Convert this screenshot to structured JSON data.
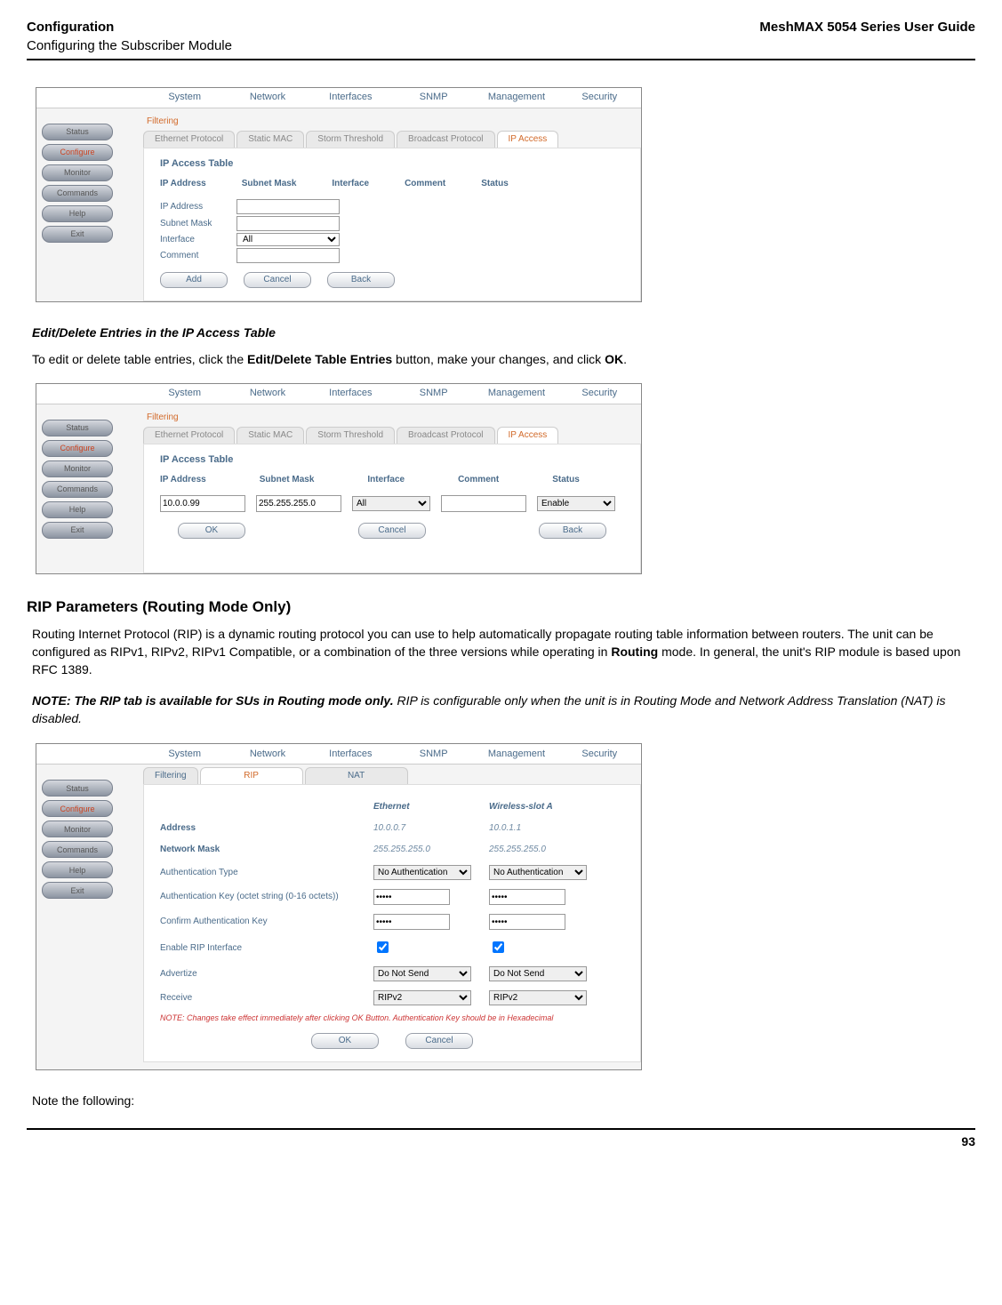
{
  "header": {
    "left_top": "Configuration",
    "left_bottom": "Configuring the Subscriber Module",
    "right": "MeshMAX 5054 Series User Guide"
  },
  "footer": {
    "page": "93"
  },
  "common": {
    "topnav": [
      "System",
      "Network",
      "Interfaces",
      "SNMP",
      "Management",
      "Security"
    ],
    "leftnav": [
      "Status",
      "Configure",
      "Monitor",
      "Commands",
      "Help",
      "Exit"
    ],
    "filter_subtab": "Filtering",
    "subtabs": [
      "Ethernet Protocol",
      "Static MAC",
      "Storm Threshold",
      "Broadcast Protocol",
      "IP Access"
    ]
  },
  "screenshot1": {
    "panel_title": "IP Access Table",
    "columns": [
      "IP Address",
      "Subnet Mask",
      "Interface",
      "Comment",
      "Status"
    ],
    "form": {
      "ip_label": "IP Address",
      "mask_label": "Subnet Mask",
      "iface_label": "Interface",
      "iface_value": "All",
      "comment_label": "Comment"
    },
    "buttons": {
      "add": "Add",
      "cancel": "Cancel",
      "back": "Back"
    }
  },
  "section_edit": {
    "heading": "Edit/Delete Entries in the IP Access Table",
    "para_prefix": "To edit or delete table entries, click the ",
    "para_bold": "Edit/Delete Table Entries",
    "para_mid": " button, make your changes, and click ",
    "para_ok": "OK",
    "para_suffix": "."
  },
  "screenshot2": {
    "panel_title": "IP Access Table",
    "columns": [
      "IP Address",
      "Subnet Mask",
      "Interface",
      "Comment",
      "Status"
    ],
    "row": {
      "ip": "10.0.0.99",
      "mask": "255.255.255.0",
      "iface": "All",
      "comment": "",
      "status": "Enable"
    },
    "buttons": {
      "ok": "OK",
      "cancel": "Cancel",
      "back": "Back"
    }
  },
  "section_rip": {
    "heading": "RIP Parameters (Routing Mode Only)",
    "para_prefix": "Routing Internet Protocol (RIP) is a dynamic routing protocol you can use to help automatically propagate routing table information between routers. The unit can be configured as RIPv1, RIPv2, RIPv1 Compatible, or a combination of the three versions while operating in ",
    "para_bold": "Routing",
    "para_suffix": " mode. In general, the unit's RIP module is based upon RFC 1389.",
    "note_label": "NOTE:",
    "note_bold": "The RIP tab is available for SUs in Routing mode only.",
    "note_italic": " RIP is configurable only when the unit is in Routing Mode and Network Address Translation (NAT) is disabled.",
    "trailing": "Note the following:"
  },
  "screenshot3": {
    "subtabs": [
      "Filtering",
      "RIP",
      "NAT"
    ],
    "col_eth": "Ethernet",
    "col_wls": "Wireless-slot A",
    "rows": {
      "address": {
        "label": "Address",
        "eth": "10.0.0.7",
        "wls": "10.0.1.1"
      },
      "mask": {
        "label": "Network Mask",
        "eth": "255.255.255.0",
        "wls": "255.255.255.0"
      },
      "auth_type": {
        "label": "Authentication Type",
        "eth": "No Authentication",
        "wls": "No Authentication"
      },
      "auth_key": {
        "label": "Authentication Key (octet string (0-16 octets))",
        "eth": "*****",
        "wls": "*****"
      },
      "confirm": {
        "label": "Confirm Authentication Key",
        "eth": "*****",
        "wls": "*****"
      },
      "enable": {
        "label": "Enable RIP Interface"
      },
      "advertize": {
        "label": "Advertize",
        "eth": "Do Not Send",
        "wls": "Do Not Send"
      },
      "receive": {
        "label": "Receive",
        "eth": "RIPv2",
        "wls": "RIPv2"
      }
    },
    "note": "NOTE: Changes take effect immediately after clicking OK Button. Authentication Key should be in Hexadecimal",
    "buttons": {
      "ok": "OK",
      "cancel": "Cancel"
    }
  }
}
